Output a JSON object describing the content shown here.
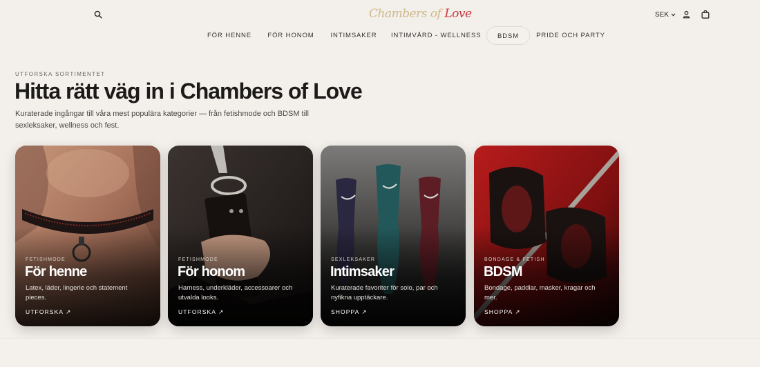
{
  "header": {
    "logo": {
      "part1": "Chambers of ",
      "part2": "Love"
    },
    "currency": "SEK",
    "icons": {
      "search": "search-icon",
      "user": "user-icon",
      "bag": "bag-icon",
      "caret": "chevron-down-icon"
    }
  },
  "nav": {
    "items": [
      {
        "label": "FÖR HENNE",
        "active": false
      },
      {
        "label": "FÖR HONOM",
        "active": false
      },
      {
        "label": "INTIMSAKER",
        "active": false
      },
      {
        "label": "INTIMVÅRD - WELLNESS",
        "active": false
      },
      {
        "label": "BDSM",
        "active": true
      },
      {
        "label": "PRIDE OCH PARTY",
        "active": false
      }
    ]
  },
  "hero": {
    "eyebrow": "UTFORSKA SORTIMENTET",
    "title": "Hitta rätt väg in i Chambers of Love",
    "lead": "Kuraterade ingångar till våra mest populära kategorier — från fetishmode och BDSM till sexleksaker, wellness och fest."
  },
  "cards": [
    {
      "kicker": "FETISHMODE",
      "title": "För henne",
      "desc": "Latex, läder, lingerie och statement pieces.",
      "cta": "UTFORSKA ↗"
    },
    {
      "kicker": "FETISHMODE",
      "title": "För honom",
      "desc": "Harness, underkläder, accessoarer och utvalda looks.",
      "cta": "UTFORSKA ↗"
    },
    {
      "kicker": "SEXLEKSAKER",
      "title": "Intimsaker",
      "desc": "Kuraterade favoriter för solo, par och nyfikna upptäckare.",
      "cta": "SHOPPA ↗"
    },
    {
      "kicker": "BONDAGE & FETISH",
      "title": "BDSM",
      "desc": "Bondage, paddlar, masker, kragar och mer.",
      "cta": "SHOPPA ↗"
    }
  ],
  "colors": {
    "background": "#f3efea",
    "logo_gold": "#cdb98a",
    "logo_red": "#c8363d"
  }
}
